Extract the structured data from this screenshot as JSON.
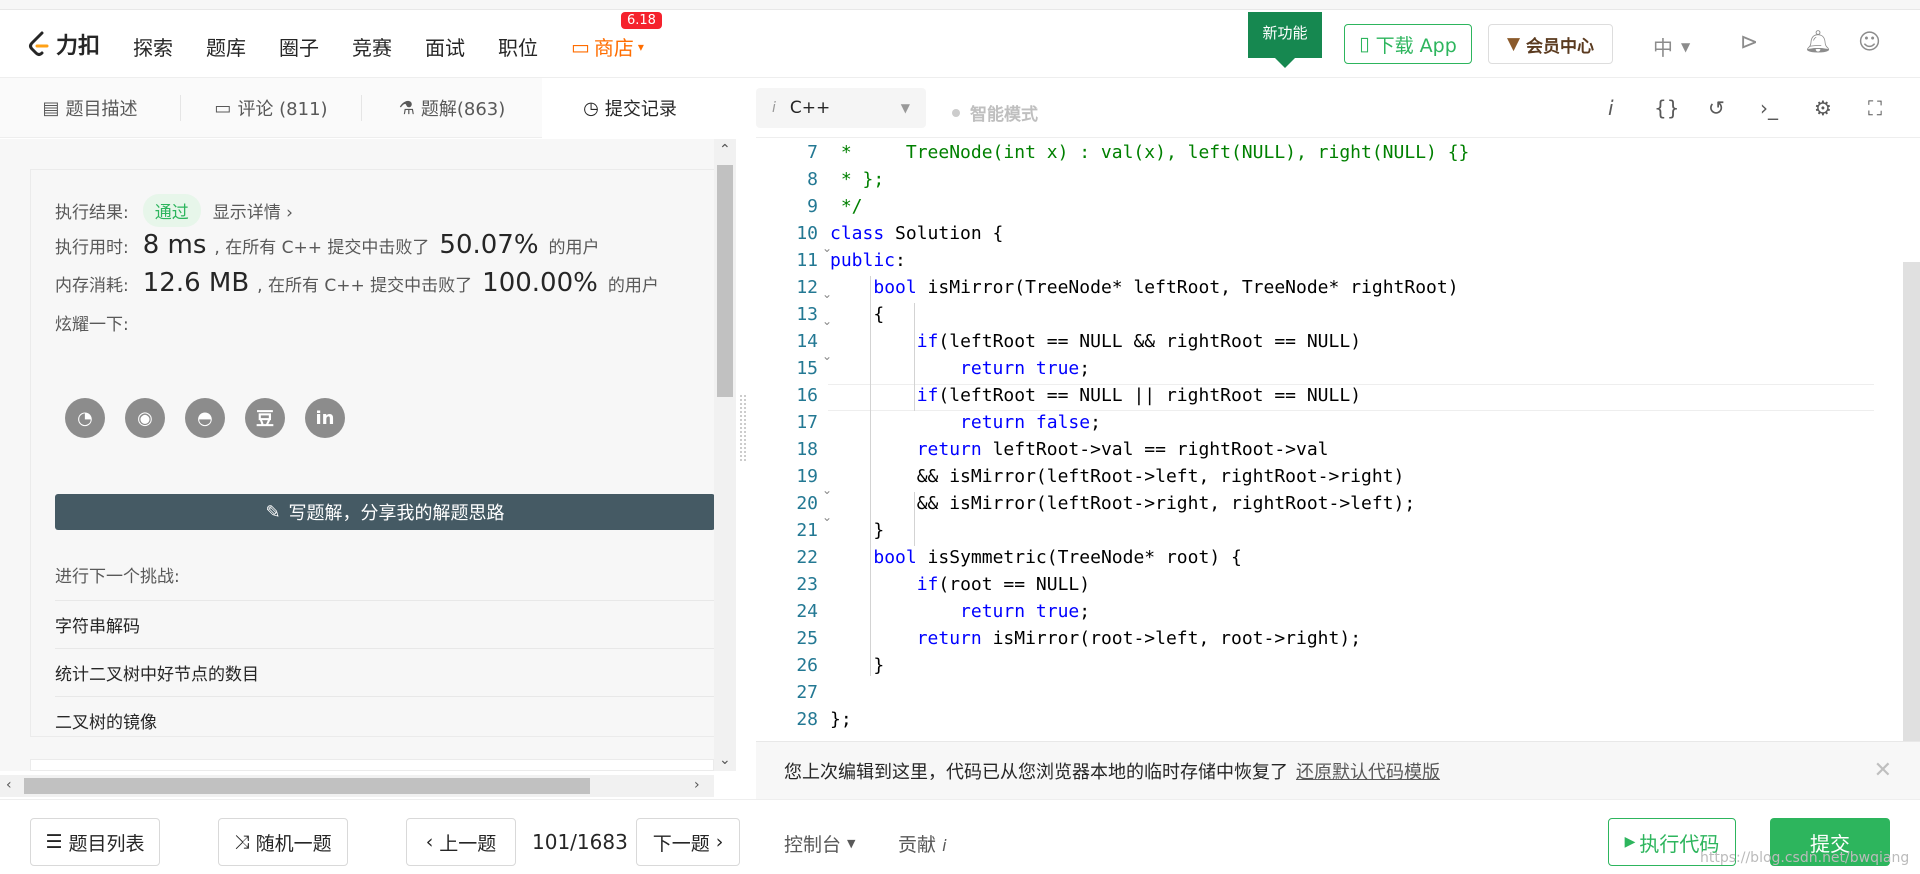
{
  "nav": {
    "logo": "力扣",
    "items": [
      "探索",
      "题库",
      "圈子",
      "竞赛",
      "面试",
      "职位"
    ],
    "shop": "商店",
    "shop_badge": "6.18",
    "new_feature": "新功能",
    "download_app": "下载 App",
    "vip": "会员中心",
    "lang": "中"
  },
  "tabs": {
    "desc": "题目描述",
    "comments": "评论 (811)",
    "solutions": "题解(863)",
    "submissions": "提交记录"
  },
  "result": {
    "label": "执行结果:",
    "status": "通过",
    "detail": "显示详情 ›",
    "time_label": "执行用时:",
    "time_value": "8 ms",
    "time_mid": ", 在所有 C++ 提交中击败了",
    "time_pct": "50.07%",
    "time_end": "的用户",
    "mem_label": "内存消耗:",
    "mem_value": "12.6 MB",
    "mem_mid": ", 在所有 C++ 提交中击败了",
    "mem_pct": "100.00%",
    "mem_end": "的用户",
    "share_label": "炫耀一下:",
    "share_douban": "豆",
    "share_linkedin": "in",
    "write_solution": "写题解，分享我的解题思路",
    "next_label": "进行下一个挑战:",
    "next_items": [
      "字符串解码",
      "统计二叉树中好节点的数目",
      "二叉树的镜像"
    ]
  },
  "editor": {
    "language": "C++",
    "smart_mode": "智能模式",
    "info_icon": "i",
    "braces_icon": "{}",
    "line_numbers": [
      "7",
      "8",
      "9",
      "10",
      "11",
      "12",
      "13",
      "14",
      "15",
      "16",
      "17",
      "18",
      "19",
      "20",
      "21",
      "22",
      "23",
      "24",
      "25",
      "26",
      "27",
      "28"
    ]
  },
  "restore": {
    "text": "您上次编辑到这里，代码已从您浏览器本地的临时存储中恢复了",
    "link": "还原默认代码模版"
  },
  "footer": {
    "problem_list": "题目列表",
    "random": "随机一题",
    "prev": "上一题",
    "counter": "101/1683",
    "next": "下一题",
    "console": "控制台",
    "contribute": "贡献",
    "run": "执行代码",
    "submit": "提交",
    "watermark": "https://blog.csdn.net/bwqiang"
  }
}
